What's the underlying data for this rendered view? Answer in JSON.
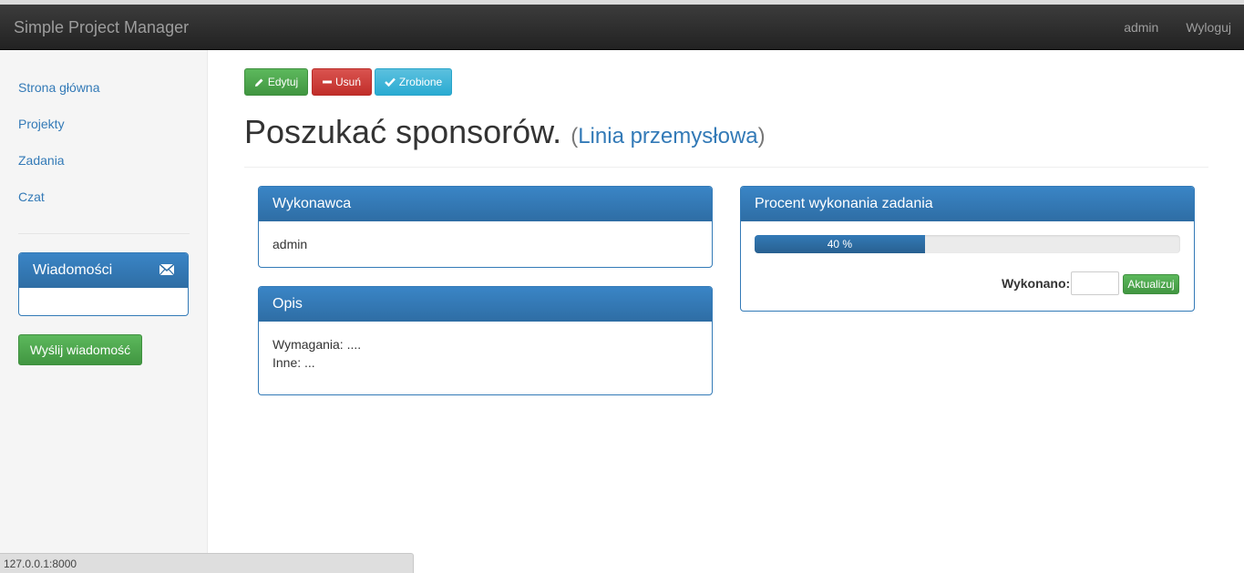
{
  "navbar": {
    "brand": "Simple Project Manager",
    "user": "admin",
    "logout": "Wyloguj"
  },
  "sidebar": {
    "items": [
      {
        "label": "Strona główna"
      },
      {
        "label": "Projekty"
      },
      {
        "label": "Zadania"
      },
      {
        "label": "Czat"
      }
    ],
    "messages_title": "Wiadomości",
    "send_button": "Wyślij wiadomość"
  },
  "toolbar": {
    "edit": "Edytuj",
    "delete": "Usuń",
    "done": "Zrobione"
  },
  "task": {
    "title": "Poszukać sponsorów.",
    "project": "Linia przemysłowa"
  },
  "executor_panel": {
    "title": "Wykonawca",
    "value": "admin"
  },
  "description_panel": {
    "title": "Opis",
    "line1": "Wymagania: ....",
    "line2": "Inne: ..."
  },
  "progress_panel": {
    "title": "Procent wykonania zadania",
    "progress_percent": 40,
    "progress_label": "40 %",
    "done_label": "Wykonano:",
    "done_input_value": "",
    "update_button": "Aktualizuj"
  },
  "statusbar": {
    "url": "127.0.0.1:8000"
  },
  "colors": {
    "primary": "#337ab7",
    "success": "#5cb85c",
    "danger": "#d9534f",
    "info": "#5bc0de",
    "navbar": "#222222"
  }
}
